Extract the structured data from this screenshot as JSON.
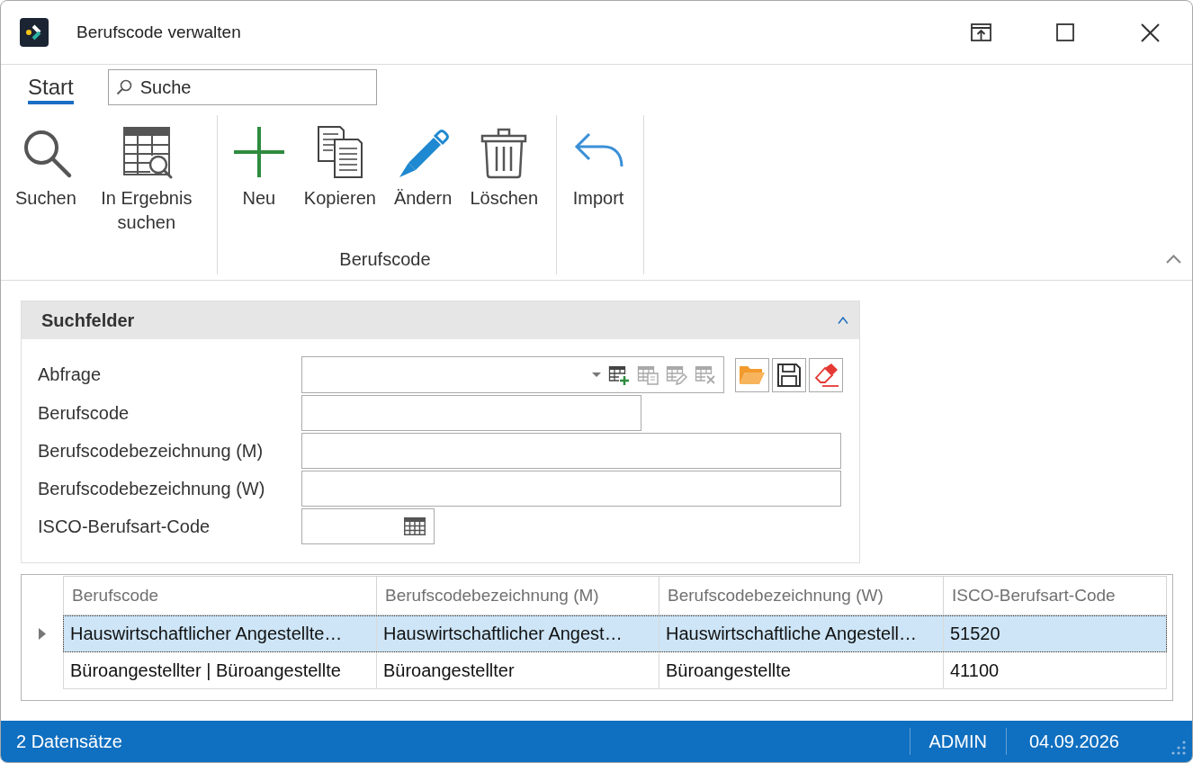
{
  "window": {
    "title": "Berufscode verwalten"
  },
  "ribbon": {
    "tabs": [
      {
        "label": "Start",
        "selected": true
      }
    ],
    "search": {
      "placeholder": "Suche"
    },
    "groups": [
      {
        "buttons": [
          {
            "label": "Suchen"
          },
          {
            "label": "In Ergebnis suchen"
          }
        ]
      },
      {
        "label": "Berufscode",
        "buttons": [
          {
            "label": "Neu"
          },
          {
            "label": "Kopieren"
          },
          {
            "label": "Ändern"
          },
          {
            "label": "Löschen"
          }
        ]
      },
      {
        "buttons": [
          {
            "label": "Import"
          }
        ]
      }
    ]
  },
  "search_panel": {
    "title": "Suchfelder",
    "expanded": true,
    "fields": [
      {
        "label": "Abfrage",
        "kind": "query",
        "tools": [
          {
            "disabled": false
          },
          {
            "disabled": true
          },
          {
            "disabled": true
          },
          {
            "disabled": true
          }
        ]
      },
      {
        "label": "Berufscode",
        "kind": "text"
      },
      {
        "label": "Berufscodebezeichnung (M)",
        "kind": "text"
      },
      {
        "label": "Berufscodebezeichnung (W)",
        "kind": "text"
      },
      {
        "label": "ISCO-Berufsart-Code",
        "kind": "lookup"
      }
    ]
  },
  "grid": {
    "columns": [
      "Berufscode",
      "Berufscodebezeichnung (M)",
      "Berufscodebezeichnung (W)",
      "ISCO-Berufsart-Code"
    ],
    "rows": [
      {
        "selected": true,
        "cells": [
          "Hauswirtschaftlicher Angestellte…",
          "Hauswirtschaftlicher Angest…",
          "Hauswirtschaftliche Angestell…",
          "51520"
        ]
      },
      {
        "selected": false,
        "cells": [
          "Büroangestellter | Büroangestellte",
          "Büroangestellter",
          "Büroangestellte",
          "41100"
        ]
      }
    ]
  },
  "status_bar": {
    "record_count": "2 Datensätze",
    "user": "ADMIN",
    "date": "04.09.2026"
  }
}
